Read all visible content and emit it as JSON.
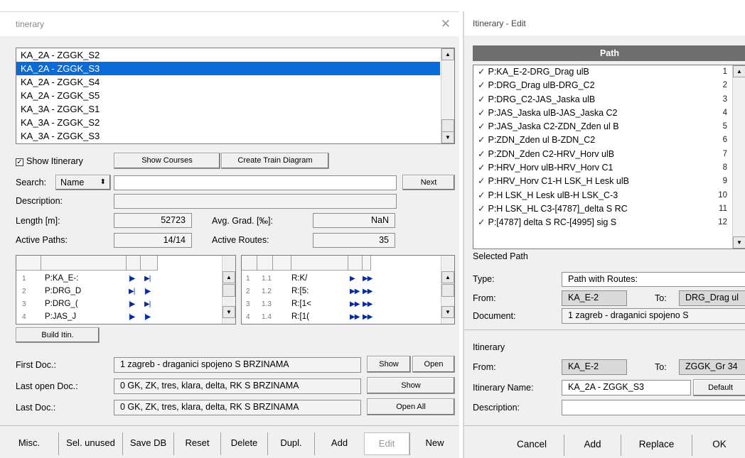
{
  "left": {
    "title": "tinerary",
    "itineraries": [
      "KA_2A - ZGGK_S2",
      "KA_2A - ZGGK_S3",
      "KA_2A - ZGGK_S4",
      "KA_2A - ZGGK_S5",
      "KA_3A - ZGGK_S1",
      "KA_3A - ZGGK_S2",
      "KA_3A - ZGGK_S3"
    ],
    "selected_index": 1,
    "show_itinerary_label": "Show Itinerary",
    "show_courses": "Show Courses",
    "create_train_diagram": "Create Train Diagram",
    "search_label": "Search:",
    "search_mode": "Name",
    "next": "Next",
    "description_label": "Description:",
    "length_label": "Length [m]:",
    "length_value": "52723",
    "avg_grad_label": "Avg. Grad. [‰]:",
    "avg_grad_value": "NaN",
    "active_paths_label": "Active Paths:",
    "active_paths_value": "14/14",
    "active_routes_label": "Active Routes:",
    "active_routes_value": "35",
    "paths_grid": [
      {
        "n": "1",
        "name": "P:KA_E-:"
      },
      {
        "n": "2",
        "name": "P:DRG_D"
      },
      {
        "n": "3",
        "name": "P:DRG_("
      },
      {
        "n": "4",
        "name": "P:JAS_J"
      }
    ],
    "routes_grid": [
      {
        "n": "1",
        "idx": "1.1",
        "name": "R:K/"
      },
      {
        "n": "2",
        "idx": "1.2",
        "name": "R:[5:"
      },
      {
        "n": "3",
        "idx": "1.3",
        "name": "R:[1<"
      },
      {
        "n": "4",
        "idx": "1.4",
        "name": "R:[1("
      }
    ],
    "build_itin": "Build Itin.",
    "first_doc_label": "First Doc.:",
    "first_doc_value": "1 zagreb -  draganici spojeno S BRZINAMA",
    "last_open_doc_label": "Last open Doc.:",
    "last_open_doc_value": "0 GK, ZK, tres, klara, delta, RK S BRZINAMA",
    "last_doc_label": "Last Doc.:",
    "last_doc_value": "0 GK, ZK, tres, klara, delta, RK S BRZINAMA",
    "show": "Show",
    "open": "Open",
    "show2": "Show",
    "open_all": "Open All",
    "bottom_buttons": [
      "Misc.",
      "Sel. unused",
      "Save DB",
      "Reset",
      "Delete",
      "Dupl.",
      "Add",
      "Edit",
      "New"
    ]
  },
  "right": {
    "title": "Itinerary - Edit",
    "path_header": "Path",
    "paths": [
      {
        "name": "P:KA_E-2-DRG_Drag ulB",
        "n": "1"
      },
      {
        "name": "P:DRG_Drag ulB-DRG_C2",
        "n": "2"
      },
      {
        "name": "P:DRG_C2-JAS_Jaska ulB",
        "n": "3"
      },
      {
        "name": "P:JAS_Jaska ulB-JAS_Jaska  C2",
        "n": "4"
      },
      {
        "name": "P:JAS_Jaska  C2-ZDN_Zden ul B",
        "n": "5"
      },
      {
        "name": "P:ZDN_Zden ul B-ZDN_C2",
        "n": "6"
      },
      {
        "name": "P:ZDN_Zden C2-HRV_Horv ulB",
        "n": "7"
      },
      {
        "name": "P:HRV_Horv ulB-HRV_Horv C1",
        "n": "8"
      },
      {
        "name": "P:HRV_Horv C1-H LSK_H Lesk ulB",
        "n": "9"
      },
      {
        "name": "P:H LSK_H Lesk ulB-H LSK_C-3",
        "n": "10"
      },
      {
        "name": "P:H LSK_HL C3-[4787]_delta S RC",
        "n": "11"
      },
      {
        "name": "P:[4787]  delta S RC-[4995]  sig S",
        "n": "12"
      }
    ],
    "selected_path_label": "Selected Path",
    "type_label": "Type:",
    "type_value": "Path with Routes:",
    "from_label": "From:",
    "from_value": "KA_E-2",
    "to_label": "To:",
    "to_value": "DRG_Drag ul",
    "document_label": "Document:",
    "document_value": "1 zagreb -  draganici spojeno S",
    "itinerary_label": "Itinerary",
    "it_from_label": "From:",
    "it_from_value": "KA_E-2",
    "it_to_label": "To:",
    "it_to_value": "ZGGK_Gr 34",
    "itinerary_name_label": "Itinerary Name:",
    "itinerary_name_value": "KA_2A - ZGGK_S3",
    "default": "Default",
    "description_label": "Description:",
    "buttons": [
      "Cancel",
      "Add",
      "Replace",
      "OK"
    ]
  }
}
